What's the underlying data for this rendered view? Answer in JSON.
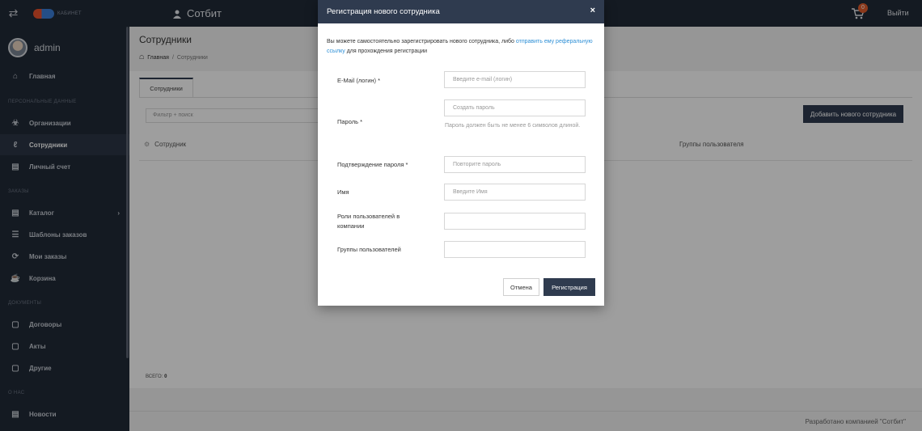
{
  "topbar": {
    "logo_text": "КАБИНЕТ",
    "brand": "Сотбит",
    "cart_count": "0",
    "logout": "Выйти"
  },
  "user": {
    "name": "admin"
  },
  "sidebar": {
    "items": [
      {
        "label": "Главная",
        "icon": "home-icon"
      },
      {
        "label": "Организации",
        "icon": "organization-icon"
      },
      {
        "label": "Сотрудники",
        "icon": "employee-icon",
        "active": true
      },
      {
        "label": "Личный счет",
        "icon": "card-icon"
      },
      {
        "label": "Каталог",
        "icon": "catalog-icon"
      },
      {
        "label": "Шаблоны заказов",
        "icon": "template-icon"
      },
      {
        "label": "Мои заказы",
        "icon": "refresh-icon"
      },
      {
        "label": "Корзина",
        "icon": "cart-icon"
      },
      {
        "label": "Договоры",
        "icon": "document-icon"
      },
      {
        "label": "Акты",
        "icon": "document-icon"
      },
      {
        "label": "Другие",
        "icon": "document-icon"
      },
      {
        "label": "Новости",
        "icon": "news-icon"
      }
    ],
    "sections": {
      "personal": "ПЕРСОНАЛЬНЫЕ ДАННЫЕ",
      "orders": "ЗАКАЗЫ",
      "documents": "ДОКУМЕНТЫ",
      "about": "О НАС"
    }
  },
  "main": {
    "title": "Сотрудники",
    "breadcrumb_home": "Главная",
    "breadcrumb_sep": "/",
    "breadcrumb_current": "Сотрудники",
    "tab": "Сотрудники",
    "filter_placeholder": "Фильтр + поиск",
    "add_button": "Добавить нового сотрудника",
    "col_employee": "Сотрудник",
    "col_groups": "Группы пользователя",
    "total_label": "ВСЕГО:",
    "total_value": "0",
    "footer": "Разработано компанией \"Сотбит\""
  },
  "modal": {
    "title": "Регистрация нового сотрудника",
    "close": "×",
    "intro_before": "Вы можете самостоятельно зарегистрировать нового сотрудника, либо ",
    "intro_link": "отправить ему реферальную ссылку",
    "intro_after": " для прохождения регистрации",
    "fields": {
      "email_label": "E-Mail (логин) *",
      "email_placeholder": "Введите e-mail (логин)",
      "password_label": "Пароль *",
      "password_placeholder": "Создать пароль",
      "password_hint": "Пароль должен быть не менее 6 символов длиной.",
      "confirm_label": "Подтверждение пароля *",
      "confirm_placeholder": "Повторите пароль",
      "name_label": "Имя",
      "name_placeholder": "Введите Имя",
      "roles_label": "Роли пользователей в компании",
      "groups_label": "Группы пользователей"
    },
    "cancel": "Отмена",
    "submit": "Регистрация"
  }
}
